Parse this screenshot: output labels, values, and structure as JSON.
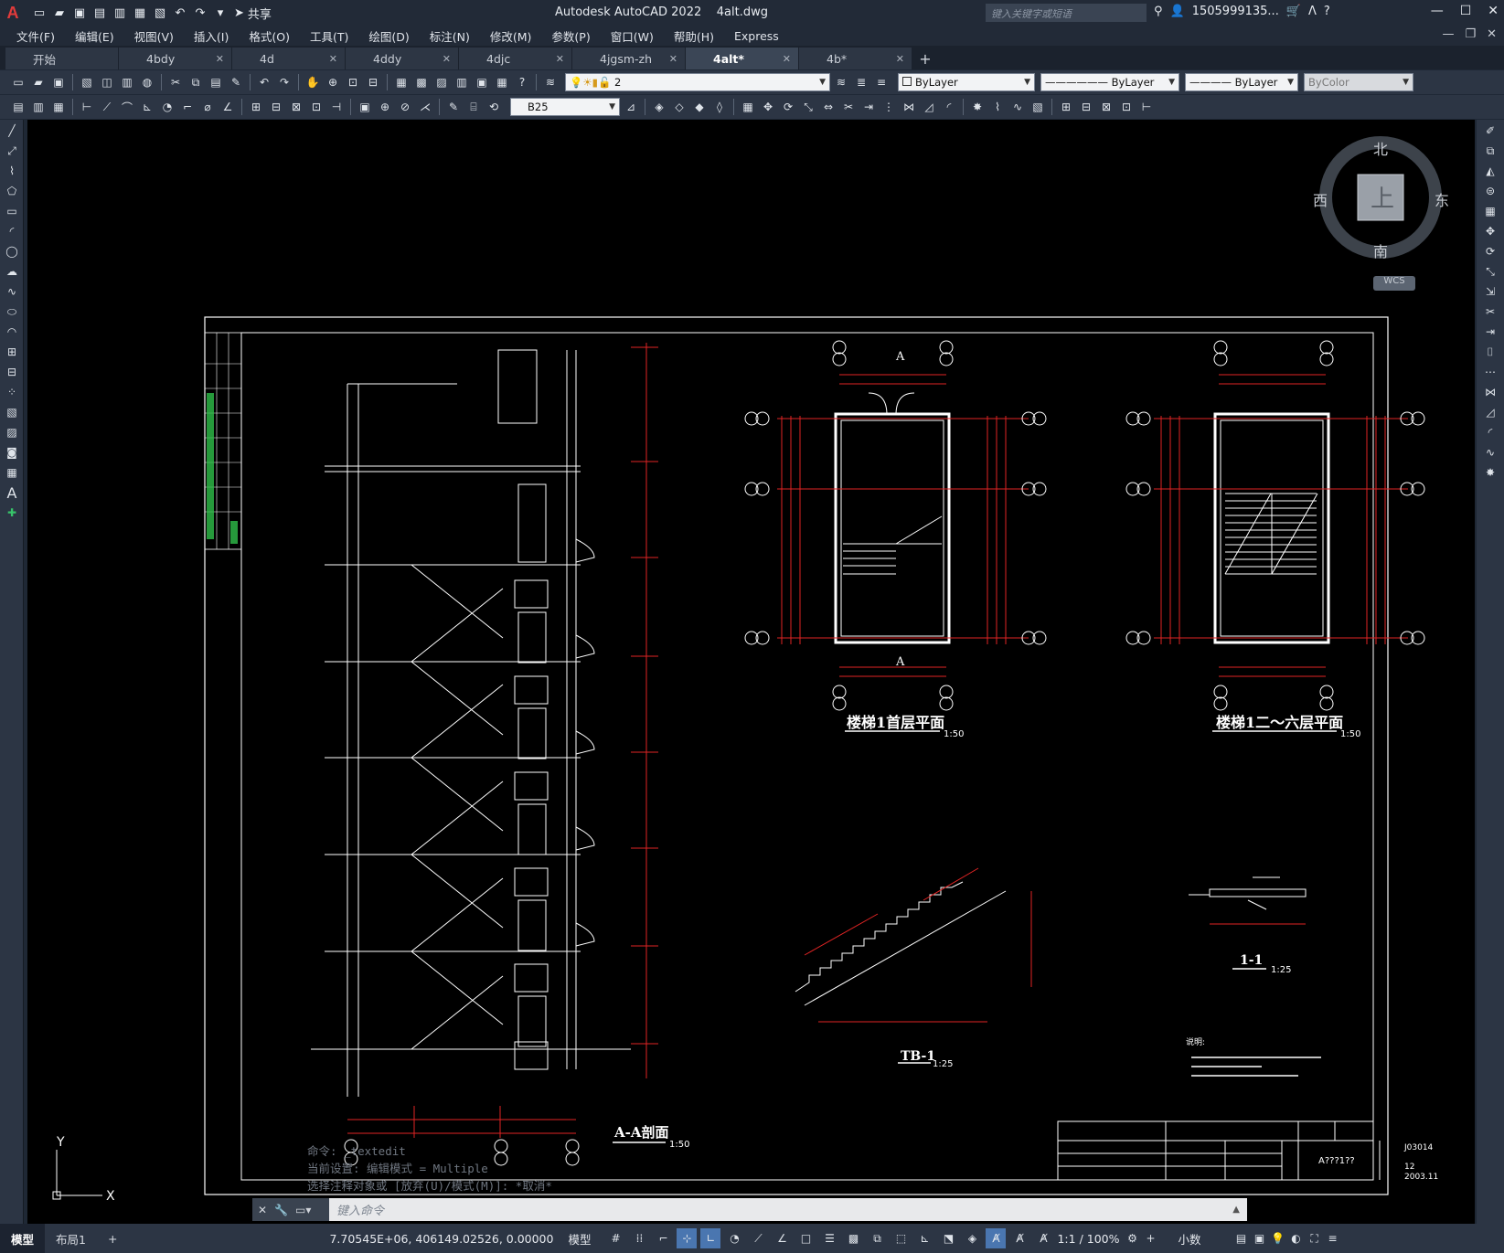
{
  "app": {
    "logo": "A",
    "title": "Autodesk AutoCAD 2022",
    "file": "4alt.dwg",
    "share_label": "共享",
    "search_placeholder": "键入关键字或短语",
    "user": "1505999135...",
    "help": "?"
  },
  "menu": [
    "文件(F)",
    "编辑(E)",
    "视图(V)",
    "插入(I)",
    "格式(O)",
    "工具(T)",
    "绘图(D)",
    "标注(N)",
    "修改(M)",
    "参数(P)",
    "窗口(W)",
    "帮助(H)",
    "Express"
  ],
  "tabs": [
    {
      "label": "开始",
      "active": false
    },
    {
      "label": "4bdy",
      "active": false
    },
    {
      "label": "4d",
      "active": false
    },
    {
      "label": "4ddy",
      "active": false
    },
    {
      "label": "4djc",
      "active": false
    },
    {
      "label": "4jgsm-zh",
      "active": false
    },
    {
      "label": "4alt*",
      "active": true
    },
    {
      "label": "4b*",
      "active": false
    }
  ],
  "toolbar": {
    "layer_value": "2",
    "color_value": "ByLayer",
    "linetype_value": "ByLayer",
    "lineweight_value": "ByLayer",
    "plotstyle_value": "ByColor",
    "textstyle_value": "B25"
  },
  "viewcube": {
    "north": "北",
    "south": "南",
    "east": "东",
    "west": "西",
    "face": "上",
    "wcs": "WCS"
  },
  "drawing": {
    "section_title": "A-A剖面",
    "section_scale": "1:50",
    "plan1_title": "楼梯1首层平面",
    "plan1_scale": "1:50",
    "plan2_title": "楼梯1二～六层平面",
    "plan2_scale": "1:50",
    "tb_title": "TB-1",
    "tb_scale": "1:25",
    "detail_title": "1-1",
    "detail_scale": "1:25",
    "notes_title": "说明:",
    "cut_mark": "A",
    "axis_labels": [
      "21",
      "19",
      "K",
      "N",
      "A",
      "C",
      "B",
      "1",
      "2",
      "3"
    ],
    "title_block": {
      "drawing_no": "A???1??",
      "code": "J03014",
      "sheet": "12",
      "year": "2003.11"
    }
  },
  "ucs": {
    "y": "Y",
    "x": "X"
  },
  "command": {
    "history": [
      "命令: _textedit",
      "当前设置: 编辑模式 = Multiple",
      "选择注释对象或 [放弃(U)/模式(M)]: *取消*"
    ],
    "placeholder": "键入命令"
  },
  "status": {
    "layout_tabs": [
      "模型",
      "布局1"
    ],
    "add_tab": "+",
    "coords": "7.70545E+06, 406149.02526, 0.00000",
    "space": "模型",
    "scale": "1:1 / 100%",
    "units": "小数"
  }
}
